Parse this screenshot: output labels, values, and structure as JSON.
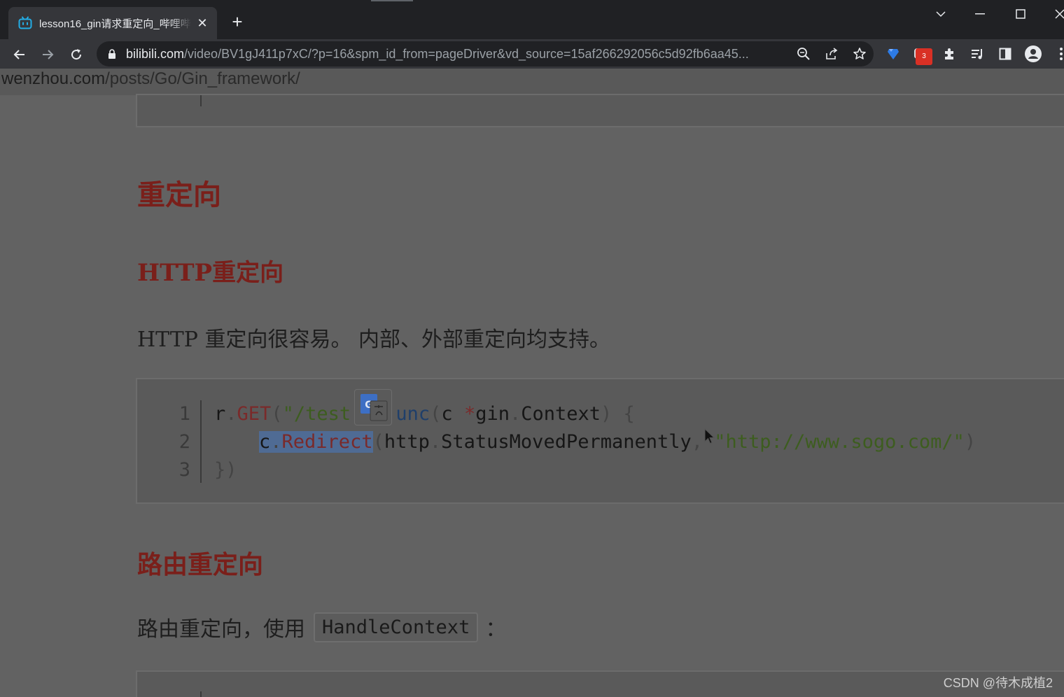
{
  "tab": {
    "title": "lesson16_gin请求重定向_哔哩哔",
    "close": "✕",
    "new_tab": "+"
  },
  "window": {
    "minimize": "—",
    "maximize": "☐",
    "close": "✕",
    "tab_search": "⌄"
  },
  "toolbar": {
    "url_host": "bilibili.com",
    "url_path": "/video/BV1gJ411p7xC/?p=16&spm_id_from=pageDriver&vd_source=15af266292056c5d92fb6aa45...",
    "extension_badge": "3"
  },
  "bookmarks": {
    "host": "wenzhou.com",
    "path": "/posts/Go/Gin_framework/"
  },
  "content": {
    "h1": "重定向",
    "h2_http": "HTTP重定向",
    "p_http": "HTTP 重定向很容易。 内部、外部重定向均支持。",
    "code1": {
      "line_numbers": [
        "1",
        "2",
        "3"
      ],
      "l1_r": "r",
      "l1_dot": ".",
      "l1_get": "GET",
      "l1_open": "(",
      "l1_str": "\"/test'",
      "l1_func": "unc",
      "l1_args_open": "(",
      "l1_c": "c ",
      "l1_star": "*",
      "l1_gin": "gin",
      "l1_dot2": ".",
      "l1_ctx": "Context",
      "l1_close": ") {",
      "l2_c": "c",
      "l2_dot": ".",
      "l2_redirect": "Redirect",
      "l2_open": "(",
      "l2_http": "http",
      "l2_dot2": ".",
      "l2_status": "StatusMovedPermanently",
      "l2_comma": ", ",
      "l2_url": "\"http://www.sogo.com/\"",
      "l2_close": ")",
      "l3": "})"
    },
    "h2_route": "路由重定向",
    "p_route_prefix": "路由重定向，使用",
    "p_route_code": "HandleContext",
    "p_route_suffix": "："
  },
  "watermark": "CSDN @待木成植2"
}
